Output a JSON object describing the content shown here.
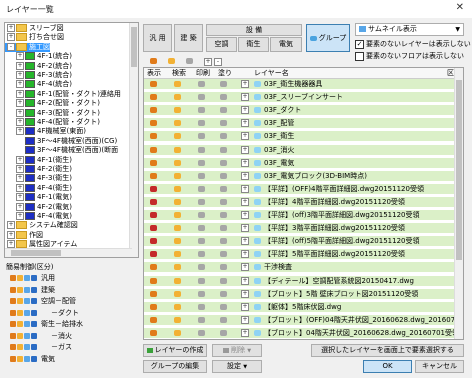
{
  "window": {
    "title": "レイヤー一覧",
    "close_glyph": "✕"
  },
  "tree": {
    "items": [
      {
        "label": "スリーブ図",
        "indent": 0,
        "exp": "+",
        "icon": "folder"
      },
      {
        "label": "打ち合せ図",
        "indent": 0,
        "exp": "+",
        "icon": "folder"
      },
      {
        "label": "施工図",
        "indent": 0,
        "exp": "-",
        "icon": "folder",
        "selected": true
      },
      {
        "label": "4F-1(統合)",
        "indent": 1,
        "exp": "+",
        "icon": "layer",
        "color": "#25b52b"
      },
      {
        "label": "4F-2(統合)",
        "indent": 1,
        "exp": "+",
        "icon": "layer",
        "color": "#25b52b"
      },
      {
        "label": "4F-3(統合)",
        "indent": 1,
        "exp": "+",
        "icon": "layer",
        "color": "#25b52b"
      },
      {
        "label": "4F-4(統合)",
        "indent": 1,
        "exp": "+",
        "icon": "layer",
        "color": "#25b52b"
      },
      {
        "label": "4F-1(配管・ダクト)連絡用",
        "indent": 1,
        "exp": "+",
        "icon": "layer",
        "color": "#25b52b"
      },
      {
        "label": "4F-2(配管・ダクト)",
        "indent": 1,
        "exp": "+",
        "icon": "layer",
        "color": "#25b52b"
      },
      {
        "label": "4F-3(配管・ダクト)",
        "indent": 1,
        "exp": "+",
        "icon": "layer",
        "color": "#25b52b"
      },
      {
        "label": "4F-4(配管・ダクト)",
        "indent": 1,
        "exp": "+",
        "icon": "layer",
        "color": "#25b52b"
      },
      {
        "label": "4F機械室(東面)",
        "indent": 1,
        "exp": "+",
        "icon": "layer",
        "color": "#1d2ec4"
      },
      {
        "label": "3F〜4F機械室(西面)(CG)",
        "indent": 1,
        "exp": "",
        "icon": "layer",
        "color": "#1d2ec4"
      },
      {
        "label": "3F〜4F機械室(西面)(断面",
        "indent": 1,
        "exp": "",
        "icon": "layer",
        "color": "#1d2ec4"
      },
      {
        "label": "4F-1(衛生)",
        "indent": 1,
        "exp": "+",
        "icon": "layer",
        "color": "#1d2ec4"
      },
      {
        "label": "4F-2(衛生)",
        "indent": 1,
        "exp": "+",
        "icon": "layer",
        "color": "#1d2ec4"
      },
      {
        "label": "4F-3(衛生)",
        "indent": 1,
        "exp": "+",
        "icon": "layer",
        "color": "#1d2ec4"
      },
      {
        "label": "4F-4(衛生)",
        "indent": 1,
        "exp": "+",
        "icon": "layer",
        "color": "#1d2ec4"
      },
      {
        "label": "4F-1(電気)",
        "indent": 1,
        "exp": "+",
        "icon": "layer",
        "color": "#1d2ec4"
      },
      {
        "label": "4F-2(電気)",
        "indent": 1,
        "exp": "+",
        "icon": "layer",
        "color": "#1d2ec4"
      },
      {
        "label": "4F-4(電気)",
        "indent": 1,
        "exp": "+",
        "icon": "layer",
        "color": "#1d2ec4"
      },
      {
        "label": "システム確認図",
        "indent": 0,
        "exp": "+",
        "icon": "folder"
      },
      {
        "label": "作図",
        "indent": 0,
        "exp": "+",
        "icon": "folder"
      },
      {
        "label": "属性図アイテム",
        "indent": 0,
        "exp": "+",
        "icon": "folder"
      }
    ]
  },
  "legend": {
    "heading": "簡易制御(区分)",
    "rows": [
      {
        "label": "汎用",
        "indent": 0
      },
      {
        "label": "建築",
        "indent": 0
      },
      {
        "label": "空調－配管",
        "indent": 0
      },
      {
        "label": "－ダクト",
        "indent": 1
      },
      {
        "label": "衛生－給排水",
        "indent": 0
      },
      {
        "label": "－消火",
        "indent": 1
      },
      {
        "label": "－ガス",
        "indent": 1
      },
      {
        "label": "電気",
        "indent": 0
      }
    ]
  },
  "category_buttons": {
    "general": "汎 用",
    "architecture": "建 築",
    "equipment": "設 備",
    "hvac": "空調",
    "sanitary": "衛生",
    "electrical": "電気",
    "group": "グループ"
  },
  "thumbnail": {
    "label": "サムネイル表示",
    "arrow": "▼"
  },
  "options": {
    "hide_unneeded_layers": {
      "label": "要素のないレイヤーは表示しない",
      "checked": true
    },
    "hide_unneeded_floors": {
      "label": "要素のないフロアは表示しない",
      "checked": false
    }
  },
  "table": {
    "headers": {
      "show": "表示",
      "search": "検索",
      "print": "印刷",
      "fill": "塗り",
      "name": "レイヤー名",
      "right": "区"
    },
    "rows": [
      {
        "name": "03F_衛生機器器具",
        "icon": "#e07b1a"
      },
      {
        "name": "03F_スリーブインサート",
        "icon": "#e07b1a"
      },
      {
        "name": "03F_ダクト",
        "icon": "#e07b1a"
      },
      {
        "name": "03F_配管",
        "icon": "#e07b1a"
      },
      {
        "name": "03F_衛生",
        "icon": "#e07b1a"
      },
      {
        "name": "03F_消火",
        "icon": "#e07b1a"
      },
      {
        "name": "03F_電気",
        "icon": "#e07b1a"
      },
      {
        "name": "03F_電気ブロック(3D-BIM時点)",
        "icon": "#e07b1a"
      },
      {
        "name": "【平詳】(OFF)4階平面詳細図.dwg20151120受領",
        "icon": "#c42a2a"
      },
      {
        "name": "【平詳】4階平面詳細図.dwg20151120受領",
        "icon": "#c42a2a"
      },
      {
        "name": "【平詳】(off)3階平面詳細図.dwg20151120受領",
        "icon": "#c42a2a"
      },
      {
        "name": "【平詳】3階平面詳細図.dwg20151120受領",
        "icon": "#c42a2a"
      },
      {
        "name": "【平詳】(off)5階平面詳細図.dwg20151120受領",
        "icon": "#c42a2a"
      },
      {
        "name": "【平詳】5階平面詳細図.dwg20151120受領",
        "icon": "#c42a2a"
      },
      {
        "name": "干渉検査",
        "icon": "#e07b1a"
      },
      {
        "name": "【ディテール】空調配管系統図20150417.dwg",
        "icon": "#e07b1a"
      },
      {
        "name": "【ブロット】5階 壁床ブロット図20151120受領",
        "icon": "#e07b1a"
      },
      {
        "name": "【躯体】5階床伏図.dwg",
        "icon": "#e07b1a"
      },
      {
        "name": "【ブロット】(OFF)04階天井伏図_20160628.dwg_20160701受",
        "icon": "#e07b1a"
      },
      {
        "name": "【ブロット】04階天井伏図_20160628.dwg_20160701受領",
        "icon": "#e07b1a"
      }
    ]
  },
  "bottom_buttons": {
    "create_layer": "レイヤーの作成",
    "delete": "削除",
    "edit_group": "グループの編集",
    "settings": "設定",
    "show_selected": "選択したレイヤーを画面上で要素選択する",
    "ok": "OK",
    "cancel": "キャンセル"
  },
  "glyphs": {
    "plus": "+",
    "minus": "-",
    "dropdown": "▼",
    "check": "✓"
  }
}
